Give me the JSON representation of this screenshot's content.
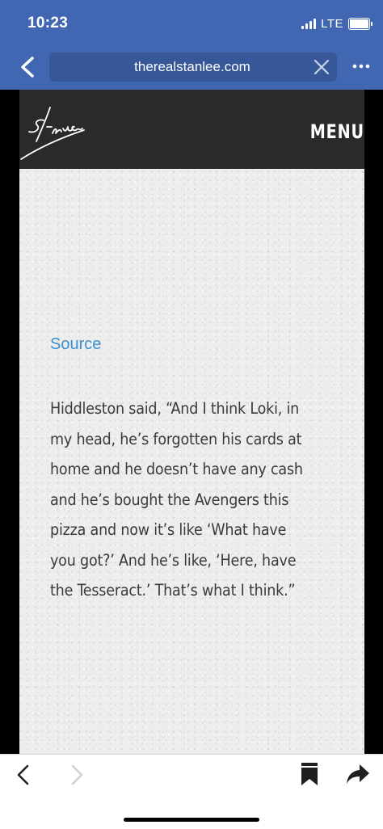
{
  "status": {
    "time": "10:23",
    "network": "LTE",
    "signal_bars": 4,
    "battery_level": 1.0
  },
  "browser": {
    "url": "therealstanlee.com",
    "back_icon": "chevron-left-icon",
    "clear_icon": "close-icon",
    "more_icon": "ellipsis-icon"
  },
  "site": {
    "logo_signature": "Stan Lee",
    "menu_label": "MENU"
  },
  "article": {
    "source_label": "Source",
    "lines": [
      "Hiddleston said, “And I think Loki, in",
      "my head, he’s forgotten his cards at",
      "home and he doesn’t have any cash",
      "and he’s bought the Avengers this",
      "pizza and now it’s like ‘What have",
      "you got?’ And he’s like, ‘Here, have",
      "the Tesseract.’ That’s what I think.”"
    ]
  },
  "toolbar": {
    "back_icon": "back-arrow-icon",
    "forward_icon": "forward-arrow-icon",
    "bookmark_icon": "bookmark-icon",
    "share_icon": "share-icon"
  },
  "colors": {
    "chrome": "#4267b2",
    "url_bar": "#365899",
    "link": "#3a8fcf",
    "header": "#2a2a2a"
  }
}
